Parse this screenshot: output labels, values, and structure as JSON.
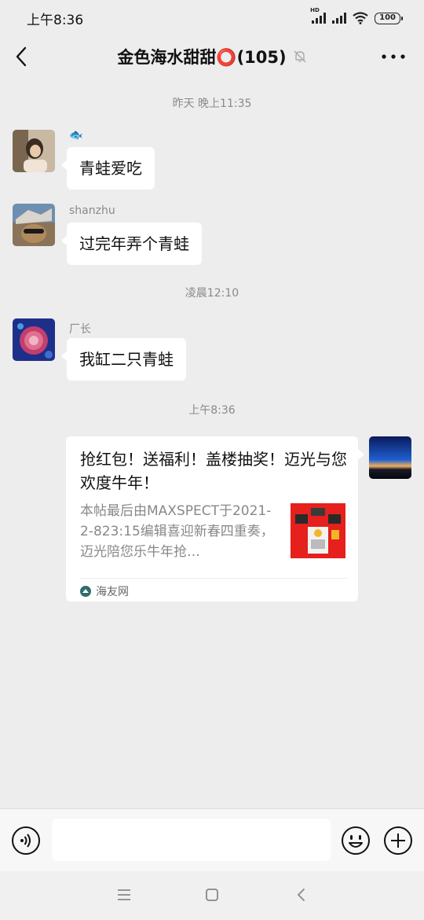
{
  "status_bar": {
    "time": "上午8:36",
    "network_label": "HD",
    "battery": "100"
  },
  "header": {
    "title": "金色海水甜甜",
    "title_emoji": "⭕",
    "member_count": "(105)"
  },
  "messages": [
    {
      "type": "timestamp",
      "text": "昨天 晚上11:35"
    },
    {
      "type": "text",
      "sender": "🐟",
      "text": "青蛙爱吃"
    },
    {
      "type": "text",
      "sender": "shanzhu",
      "text": "过完年弄个青蛙"
    },
    {
      "type": "timestamp",
      "text": "凌晨12:10"
    },
    {
      "type": "text",
      "sender": "厂长",
      "text": "我缸二只青蛙"
    },
    {
      "type": "timestamp",
      "text": "上午8:36"
    },
    {
      "type": "link",
      "sender": "",
      "title": "抢红包！送福利！盖楼抽奖！迈光与您欢度牛年！",
      "description": "本帖最后由MAXSPECT于2021-2-823:15编辑喜迎新春四重奏，迈光陪您乐牛年抢…",
      "source": "海友网"
    }
  ],
  "input": {
    "placeholder": "",
    "value": ""
  },
  "colors": {
    "background": "#ededed",
    "bubble": "#ffffff",
    "timestamp_text": "#8a8a8a",
    "source_logo": "#2d6e6a",
    "thumb_red": "#e5201d"
  }
}
